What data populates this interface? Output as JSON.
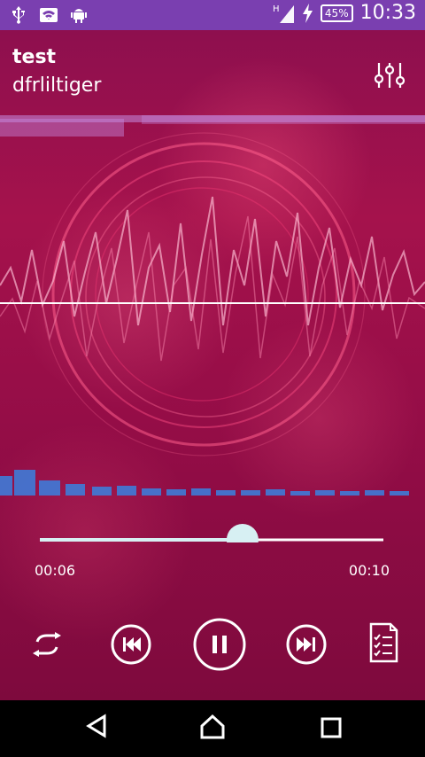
{
  "status_bar": {
    "time": "10:33",
    "battery_percent": "45%",
    "signal_type": "H",
    "left_icons": [
      "usb-icon",
      "wifi-icon",
      "android-icon"
    ],
    "right_icons": [
      "signal-icon",
      "charging-icon",
      "battery-icon"
    ]
  },
  "player": {
    "title": "test",
    "artist": "dfrliltiger",
    "current_time": "00:06",
    "total_time": "00:10",
    "progress": 0.59,
    "state": "playing"
  },
  "controls": {
    "repeat_icon": "repeat-icon",
    "previous_icon": "skip-previous-icon",
    "pause_icon": "pause-icon",
    "next_icon": "skip-next-icon",
    "playlist_icon": "playlist-icon"
  },
  "navigation_bar": {
    "back_icon": "back-icon",
    "home_icon": "home-icon",
    "recents_icon": "recents-icon"
  },
  "colors": {
    "status_bar": "#7a3fb0",
    "background": "#8e0f4e",
    "accent": "#d7f0f3",
    "waveform": "#ff4f86",
    "spectrum": "#3f7bd8"
  }
}
